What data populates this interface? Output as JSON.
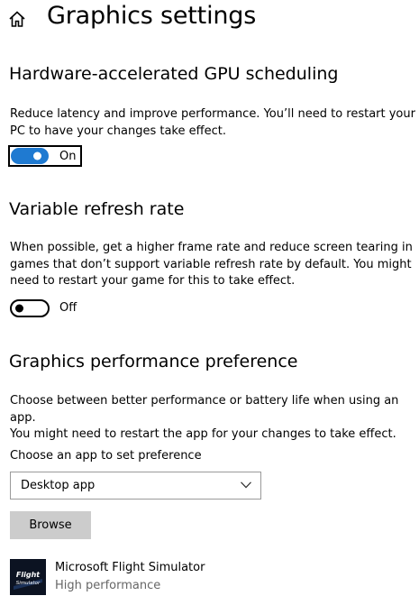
{
  "header": {
    "title": "Graphics settings",
    "home_icon": "home-icon"
  },
  "gpu_scheduling": {
    "title": "Hardware-accelerated GPU scheduling",
    "description_line1": "Reduce latency and improve performance. You’ll need to restart your",
    "description_line2": "PC to have your changes take effect.",
    "toggle_state": "On",
    "toggle_on": true
  },
  "variable_refresh": {
    "title": "Variable refresh rate",
    "description_line1": "When possible, get a higher frame rate and reduce screen tearing in",
    "description_line2": "games that don’t support variable refresh rate by default. You might",
    "description_line3": "need to restart your game for this to take effect.",
    "toggle_state": "Off",
    "toggle_on": false
  },
  "performance_preference": {
    "title": "Graphics performance preference",
    "description_line1": "Choose between better performance or battery life when using an app.",
    "description_line2": "You might need to restart the app for your changes to take effect.",
    "choose_label": "Choose an app to set preference",
    "dropdown_value": "Desktop app",
    "dropdown_icon": "chevron-down-icon",
    "browse_label": "Browse"
  },
  "apps": [
    {
      "name": "Microsoft Flight Simulator",
      "preference": "High performance",
      "logo_text": "Flight Simulator"
    }
  ],
  "colors": {
    "accent": "#1f7ad1",
    "button_bg": "#cccccc",
    "secondary_text": "#666666"
  }
}
